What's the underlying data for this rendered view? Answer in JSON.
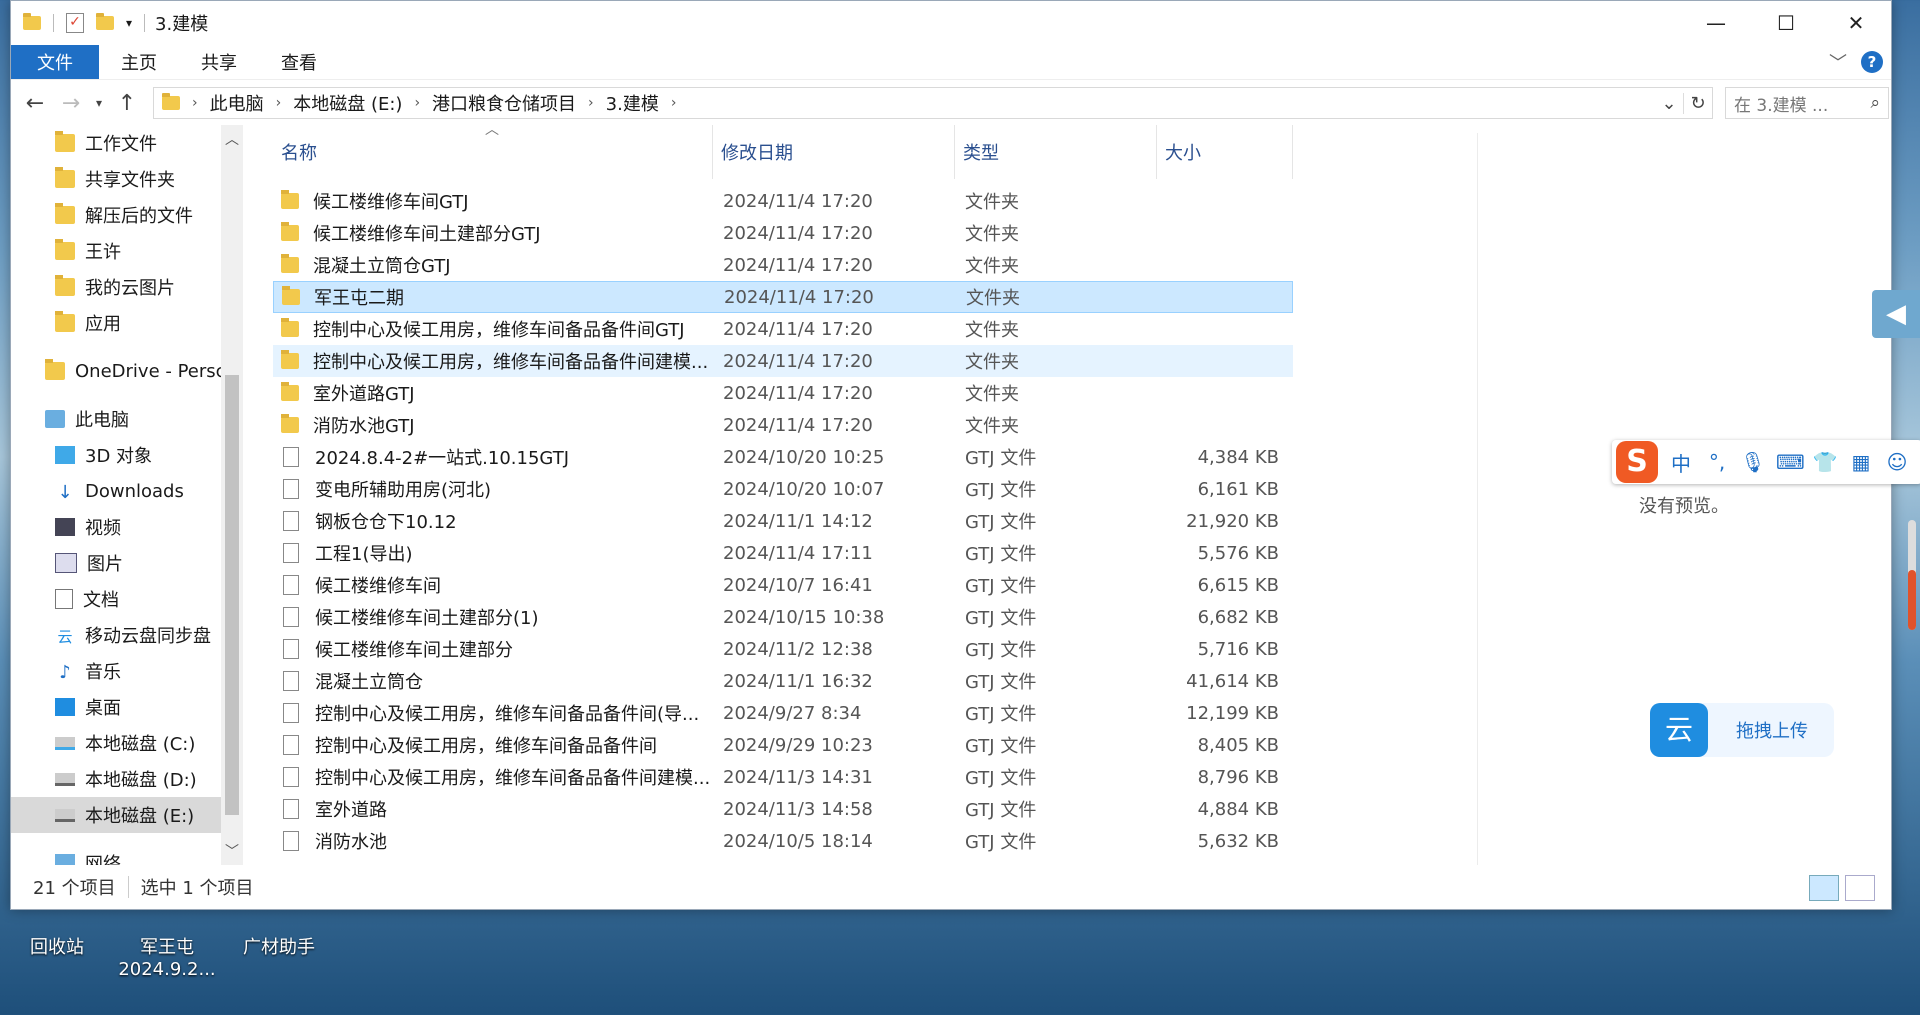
{
  "window": {
    "title": "3.建模"
  },
  "ribbon": {
    "tabs": [
      "文件",
      "主页",
      "共享",
      "查看"
    ]
  },
  "address": {
    "crumbs": [
      "此电脑",
      "本地磁盘 (E:)",
      "港口粮食仓储项目",
      "3.建模"
    ],
    "search_placeholder": "在 3.建模 ..."
  },
  "sidebar": {
    "items": [
      {
        "label": "工作文件",
        "icon": "folder-icon",
        "indent": 1
      },
      {
        "label": "共享文件夹",
        "icon": "folder-icon",
        "indent": 1
      },
      {
        "label": "解压后的文件",
        "icon": "folder-icon",
        "indent": 1
      },
      {
        "label": "王许",
        "icon": "folder-icon",
        "indent": 1
      },
      {
        "label": "我的云图片",
        "icon": "folder-icon",
        "indent": 1
      },
      {
        "label": "应用",
        "icon": "folder-icon",
        "indent": 1
      },
      {
        "label": "",
        "icon": "",
        "indent": 0
      },
      {
        "label": "OneDrive - Persc",
        "icon": "onedrive-folder-icon",
        "indent": 0
      },
      {
        "label": "",
        "icon": "",
        "indent": 0
      },
      {
        "label": "此电脑",
        "icon": "computer-icon",
        "indent": 0
      },
      {
        "label": "3D 对象",
        "icon": "3d-objects-icon",
        "indent": 1
      },
      {
        "label": "Downloads",
        "icon": "download-icon",
        "indent": 1
      },
      {
        "label": "视频",
        "icon": "video-icon",
        "indent": 1
      },
      {
        "label": "图片",
        "icon": "pictures-icon",
        "indent": 1
      },
      {
        "label": "文档",
        "icon": "documents-icon",
        "indent": 1
      },
      {
        "label": "移动云盘同步盘",
        "icon": "cloud-drive-icon",
        "indent": 1
      },
      {
        "label": "音乐",
        "icon": "music-icon",
        "indent": 1
      },
      {
        "label": "桌面",
        "icon": "desktop-icon",
        "indent": 1
      },
      {
        "label": "本地磁盘 (C:)",
        "icon": "drive-icon",
        "indent": 1
      },
      {
        "label": "本地磁盘 (D:)",
        "icon": "drive-icon",
        "indent": 1
      },
      {
        "label": "本地磁盘 (E:)",
        "icon": "drive-icon",
        "indent": 1,
        "selected": true
      },
      {
        "label": "",
        "icon": "",
        "indent": 0
      },
      {
        "label": "网络",
        "icon": "network-icon",
        "indent": 1
      }
    ]
  },
  "columns": {
    "name": "名称",
    "date": "修改日期",
    "type": "类型",
    "size": "大小"
  },
  "files": [
    {
      "name": "候工楼维修车间GTJ",
      "date": "2024/11/4 17:20",
      "type": "文件夹",
      "size": "",
      "kind": "folder"
    },
    {
      "name": "候工楼维修车间土建部分GTJ",
      "date": "2024/11/4 17:20",
      "type": "文件夹",
      "size": "",
      "kind": "folder"
    },
    {
      "name": "混凝土立筒仓GTJ",
      "date": "2024/11/4 17:20",
      "type": "文件夹",
      "size": "",
      "kind": "folder"
    },
    {
      "name": "军王屯二期",
      "date": "2024/11/4 17:20",
      "type": "文件夹",
      "size": "",
      "kind": "folder",
      "state": "selected"
    },
    {
      "name": "控制中心及候工用房，维修车间备品备件间GTJ",
      "date": "2024/11/4 17:20",
      "type": "文件夹",
      "size": "",
      "kind": "folder"
    },
    {
      "name": "控制中心及候工用房，维修车间备品备件间建模...",
      "date": "2024/11/4 17:20",
      "type": "文件夹",
      "size": "",
      "kind": "folder",
      "state": "hover"
    },
    {
      "name": "室外道路GTJ",
      "date": "2024/11/4 17:20",
      "type": "文件夹",
      "size": "",
      "kind": "folder"
    },
    {
      "name": "消防水池GTJ",
      "date": "2024/11/4 17:20",
      "type": "文件夹",
      "size": "",
      "kind": "folder"
    },
    {
      "name": "2024.8.4-2#一站式.10.15GTJ",
      "date": "2024/10/20 10:25",
      "type": "GTJ 文件",
      "size": "4,384 KB",
      "kind": "file"
    },
    {
      "name": "变电所辅助用房(河北)",
      "date": "2024/10/20 10:07",
      "type": "GTJ 文件",
      "size": "6,161 KB",
      "kind": "file"
    },
    {
      "name": "钢板仓仓下10.12",
      "date": "2024/11/1 14:12",
      "type": "GTJ 文件",
      "size": "21,920 KB",
      "kind": "file"
    },
    {
      "name": "工程1(导出)",
      "date": "2024/11/4 17:11",
      "type": "GTJ 文件",
      "size": "5,576 KB",
      "kind": "file"
    },
    {
      "name": "候工楼维修车间",
      "date": "2024/10/7 16:41",
      "type": "GTJ 文件",
      "size": "6,615 KB",
      "kind": "file"
    },
    {
      "name": "候工楼维修车间土建部分(1)",
      "date": "2024/10/15 10:38",
      "type": "GTJ 文件",
      "size": "6,682 KB",
      "kind": "file"
    },
    {
      "name": "候工楼维修车间土建部分",
      "date": "2024/11/2 12:38",
      "type": "GTJ 文件",
      "size": "5,716 KB",
      "kind": "file"
    },
    {
      "name": "混凝土立筒仓",
      "date": "2024/11/1 16:32",
      "type": "GTJ 文件",
      "size": "41,614 KB",
      "kind": "file"
    },
    {
      "name": "控制中心及候工用房，维修车间备品备件间(导...",
      "date": "2024/9/27 8:34",
      "type": "GTJ 文件",
      "size": "12,199 KB",
      "kind": "file"
    },
    {
      "name": "控制中心及候工用房，维修车间备品备件间",
      "date": "2024/9/29 10:23",
      "type": "GTJ 文件",
      "size": "8,405 KB",
      "kind": "file"
    },
    {
      "name": "控制中心及候工用房，维修车间备品备件间建模...",
      "date": "2024/11/3 14:31",
      "type": "GTJ 文件",
      "size": "8,796 KB",
      "kind": "file"
    },
    {
      "name": "室外道路",
      "date": "2024/11/3 14:58",
      "type": "GTJ 文件",
      "size": "4,884 KB",
      "kind": "file"
    },
    {
      "name": "消防水池",
      "date": "2024/10/5 18:14",
      "type": "GTJ 文件",
      "size": "5,632 KB",
      "kind": "file"
    }
  ],
  "preview": {
    "text": "没有预览。"
  },
  "status": {
    "count": "21 个项目",
    "selected": "选中 1 个项目"
  },
  "ime": {
    "logo": "S",
    "mode": "中",
    "punct": "°,"
  },
  "upload": {
    "label": "拖拽上传",
    "logo": "云"
  },
  "desktop": [
    {
      "label": "回收站"
    },
    {
      "label": "军王屯\n2024.9.2..."
    },
    {
      "label": "广材助手"
    }
  ]
}
